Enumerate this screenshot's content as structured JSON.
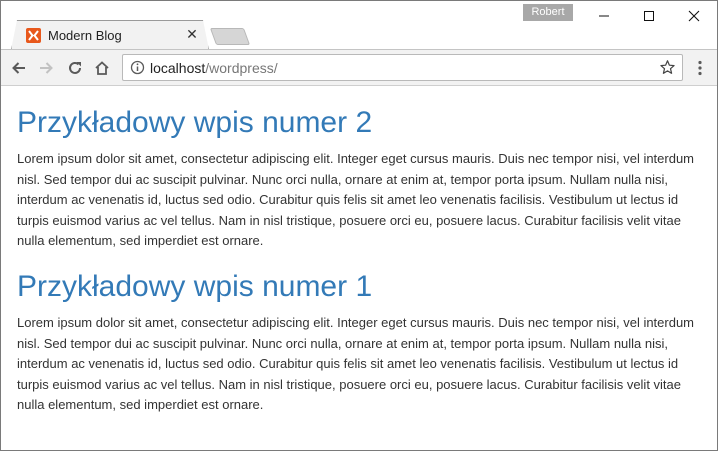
{
  "browser": {
    "profile_name": "Robert",
    "tab": {
      "title": "Modern Blog",
      "favicon": "xampp-icon",
      "close_glyph": "✕"
    },
    "url": {
      "host": "localhost",
      "path": "/wordpress/"
    },
    "colors": {
      "favicon": "#e8581c",
      "link_title": "#337ab7",
      "body_text": "#333333"
    }
  },
  "posts": [
    {
      "title": "Przykładowy wpis numer 2",
      "body": "Lorem ipsum dolor sit amet, consectetur adipiscing elit. Integer eget cursus mauris. Duis nec tempor nisi, vel interdum nisl. Sed tempor dui ac suscipit pulvinar. Nunc orci nulla, ornare at enim at, tempor porta ipsum. Nullam nulla nisi, interdum ac venenatis id, luctus sed odio. Curabitur quis felis sit amet leo venenatis facilisis. Vestibulum ut lectus id turpis euismod varius ac vel tellus. Nam in nisl tristique, posuere orci eu, posuere lacus. Curabitur facilisis velit vitae nulla elementum, sed imperdiet est ornare."
    },
    {
      "title": "Przykładowy wpis numer 1",
      "body": "Lorem ipsum dolor sit amet, consectetur adipiscing elit. Integer eget cursus mauris. Duis nec tempor nisi, vel interdum nisl. Sed tempor dui ac suscipit pulvinar. Nunc orci nulla, ornare at enim at, tempor porta ipsum. Nullam nulla nisi, interdum ac venenatis id, luctus sed odio. Curabitur quis felis sit amet leo venenatis facilisis. Vestibulum ut lectus id turpis euismod varius ac vel tellus. Nam in nisl tristique, posuere orci eu, posuere lacus. Curabitur facilisis velit vitae nulla elementum, sed imperdiet est ornare."
    }
  ]
}
